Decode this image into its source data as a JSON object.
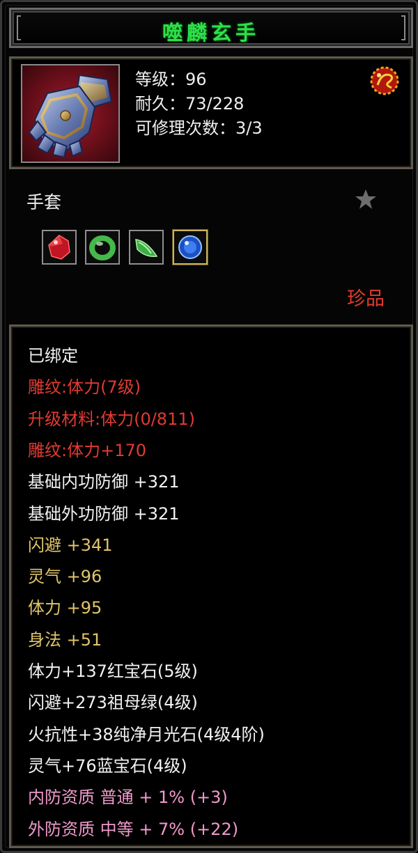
{
  "item": {
    "name": "噬麟玄手",
    "level_line": "等级：96",
    "durability_line": "耐久：73/228",
    "repair_line": "可修理次数：3/3",
    "type": "手套",
    "rarity": "珍品",
    "icon": "gauntlet-icon",
    "colors": {
      "title": "#2ee04a",
      "rarity": "#e23b2e",
      "white": "#f2f2f2",
      "red": "#e23a32",
      "gold": "#e0c56a",
      "pink": "#ef9acb"
    }
  },
  "sockets": [
    {
      "gem": "ruby-gem-icon",
      "color": "#d21a2a"
    },
    {
      "gem": "emerald-ring-gem-icon",
      "color": "#3cb443"
    },
    {
      "gem": "emerald-gem-icon",
      "color": "#3fb048"
    },
    {
      "gem": "sapphire-gem-icon",
      "color": "#2a63d8"
    }
  ],
  "attributes": [
    {
      "text": "已绑定",
      "color": "white"
    },
    {
      "text": "雕纹:体力(7级)",
      "color": "red"
    },
    {
      "text": "升级材料:体力(0/811)",
      "color": "red"
    },
    {
      "text": "雕纹:体力+170",
      "color": "red"
    },
    {
      "text": "基础内功防御 +321",
      "color": "white"
    },
    {
      "text": "基础外功防御 +321",
      "color": "white"
    },
    {
      "text": "闪避 +341",
      "color": "gold"
    },
    {
      "text": "灵气 +96",
      "color": "gold"
    },
    {
      "text": "体力 +95",
      "color": "gold"
    },
    {
      "text": "身法 +51",
      "color": "gold"
    },
    {
      "text": "体力+137红宝石(5级)",
      "color": "white"
    },
    {
      "text": "闪避+273祖母绿(4级)",
      "color": "white"
    },
    {
      "text": "火抗性+38纯净月光石(4级4阶)",
      "color": "white"
    },
    {
      "text": "灵气+76蓝宝石(4级)",
      "color": "white"
    },
    {
      "text": "内防资质 普通 + 1% (+3)",
      "color": "pink"
    },
    {
      "text": "外防资质 中等 + 7% (+22)",
      "color": "pink"
    }
  ]
}
